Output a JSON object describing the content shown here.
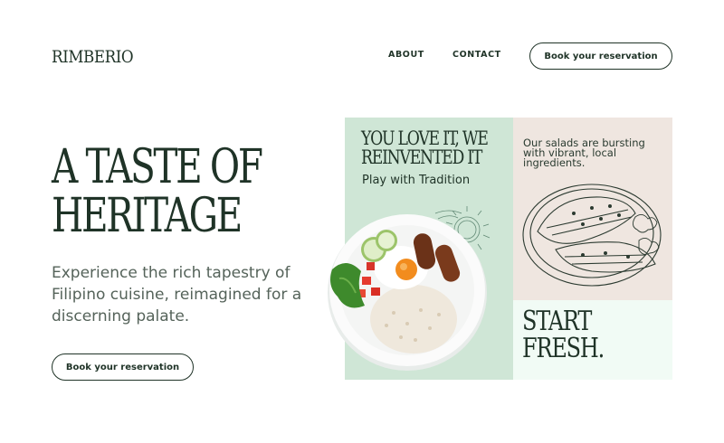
{
  "brand": {
    "logo": "RIMBERIO"
  },
  "nav": {
    "about": "ABOUT",
    "contact": "CONTACT",
    "cta": "Book your reservation"
  },
  "hero": {
    "title_line1": "A TASTE OF",
    "title_line2": "HERITAGE",
    "subtitle": "Experience the rich tapestry of Filipino cuisine, reimagined for a discerning palate.",
    "cta": "Book your reservation"
  },
  "collage": {
    "green_title_line1": "YOU LOVE IT, WE",
    "green_title_line2": "REINVENTED IT",
    "green_subtitle": "Play with Tradition",
    "salad_text": "Our salads are bursting with vibrant, local ingredients.",
    "start_line1": "START",
    "start_line2": "FRESH.",
    "images": [
      "plate-of-rice-egg-sausage-photo",
      "salad-plate-line-drawing",
      "sun-doodle"
    ]
  },
  "colors": {
    "text_dark": "#1f3327",
    "text_muted": "#55635a",
    "panel_green": "#cfe6d6",
    "panel_beige": "#efe6e0",
    "panel_mint": "#f1fbf5",
    "background": "#ffffff"
  }
}
